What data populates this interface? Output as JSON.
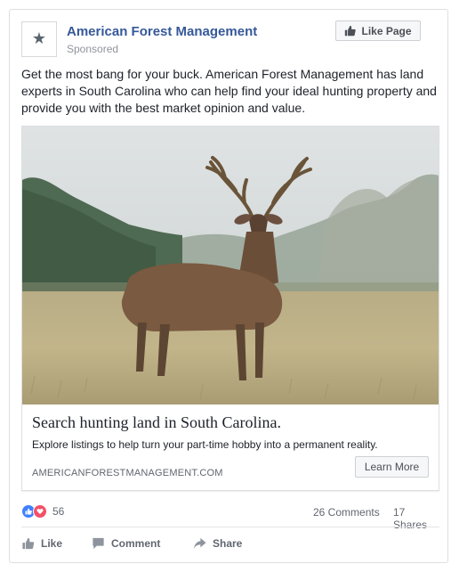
{
  "post": {
    "page_name": "American Forest Management",
    "sponsored_label": "Sponsored",
    "like_page_label": "Like Page",
    "logo_icon": "star-icon",
    "text": "Get the most bang for your buck. American Forest Management has land experts in South Carolina who can help find your ideal hunting property and provide you with the best market opinion and value."
  },
  "attachment": {
    "image_subject": "deer-photo",
    "headline": "Search hunting land in South Carolina.",
    "description": "Explore listings to help turn your part-time hobby into a permanent reality.",
    "domain": "AMERICANFORESTMANAGEMENT.COM",
    "cta_label": "Learn More"
  },
  "stats": {
    "reaction_count": "56",
    "comments": "26 Comments",
    "shares": "17 Shares"
  },
  "actions": {
    "like": "Like",
    "comment": "Comment",
    "share": "Share"
  },
  "colors": {
    "link_blue": "#365899",
    "like_blue": "#4080ff",
    "love_red": "#f25268",
    "muted_text": "#90949c"
  }
}
